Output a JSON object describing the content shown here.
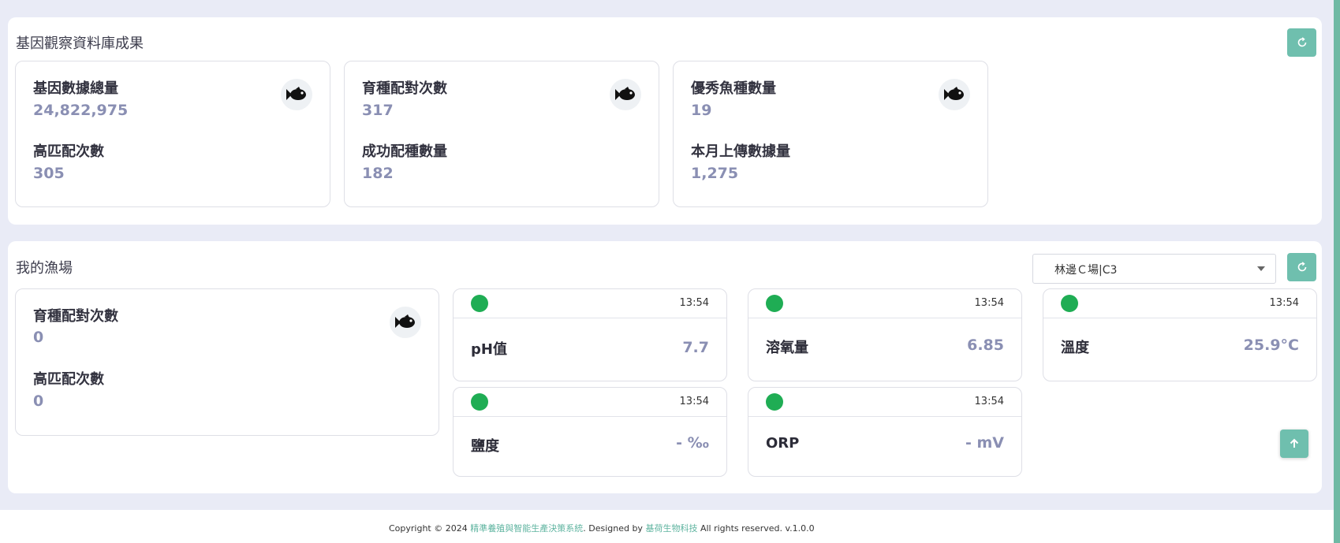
{
  "gene_panel": {
    "title": "基因觀察資料庫成果",
    "cards": [
      {
        "label1": "基因數據總量",
        "value1": "24,822,975",
        "label2": "高匹配次數",
        "value2": "305"
      },
      {
        "label1": "育種配對次數",
        "value1": "317",
        "label2": "成功配種數量",
        "value2": "182"
      },
      {
        "label1": "優秀魚種數量",
        "value1": "19",
        "label2": "本月上傳數據量",
        "value2": "1,275"
      }
    ]
  },
  "farm_panel": {
    "title": "我的漁場",
    "select_value": "林邊Ｃ場|C3",
    "summary": {
      "label1": "育種配對次數",
      "value1": "0",
      "label2": "高匹配次數",
      "value2": "0"
    },
    "sensors": [
      {
        "time": "13:54",
        "label": "pH值",
        "value": "7.7",
        "status_color": "#1fad54"
      },
      {
        "time": "13:54",
        "label": "溶氧量",
        "value": "6.85",
        "status_color": "#1fad54"
      },
      {
        "time": "13:54",
        "label": "溫度",
        "value": "25.9°C",
        "status_color": "#1fad54"
      },
      {
        "time": "13:54",
        "label": "鹽度",
        "value": "- ‰",
        "status_color": "#1fad54"
      },
      {
        "time": "13:54",
        "label": "ORP",
        "value": "- mV",
        "status_color": "#1fad54"
      }
    ]
  },
  "footer": {
    "prefix": "Copyright © 2024 ",
    "system_name": "精準養殖與智能生產決策系統",
    "designed_by": ". Designed by ",
    "company": "基荷生物科技",
    "suffix": " All rights reserved. v.1.0.0"
  },
  "icons": {
    "fish": "fish-icon",
    "refresh": "refresh-icon",
    "arrow_up": "arrow-up-icon"
  },
  "colors": {
    "accent": "#6fbfae",
    "status_ok": "#1fad54",
    "value": "#8a8fb3"
  }
}
